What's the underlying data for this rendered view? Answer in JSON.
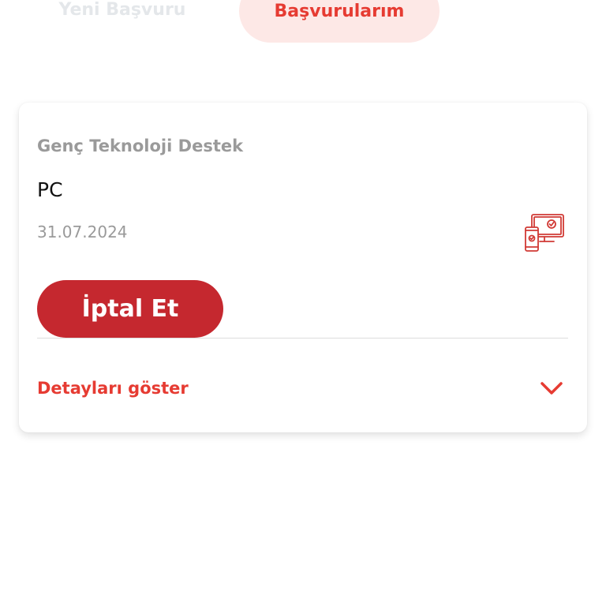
{
  "tabs": {
    "new_application": "Yeni Başvuru",
    "my_applications": "Başvurularım"
  },
  "application": {
    "program": "Genç Teknoloji Destek",
    "device": "PC",
    "date": "31.07.2024",
    "icon": "devices-check-icon",
    "cancel_label": "İptal Et",
    "details_label": "Detayları göster"
  },
  "colors": {
    "accent": "#e63b32",
    "button": "#c5282f",
    "tab_active_bg": "#fde8e6",
    "muted_text": "#9a9a9a"
  }
}
